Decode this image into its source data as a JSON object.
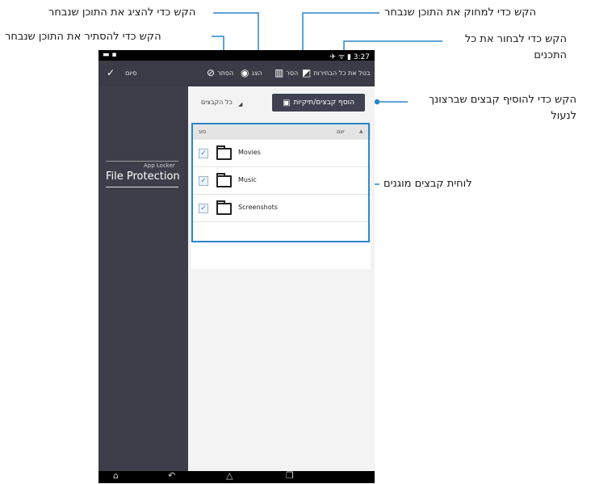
{
  "callouts": {
    "show": "הקש כדי להציג את התוכן שנבחר",
    "hide": "הקש כדי להסתיר את התוכן שנבחר",
    "delete": "הקש כדי למחוק את התוכן שנבחר",
    "select_all": "הקש כדי לבחור את כל התכנים",
    "add_files": "הקש כדי להוסיף קבצים שברצונך לנעול",
    "protected_list": "לוחית קבצים מוגנים"
  },
  "status_bar": {
    "time": "3:27",
    "left_icons": "▬ ▪",
    "right_icons": "✈ ᯤ ▮"
  },
  "action_bar": {
    "done_label": "סיום",
    "hide_label": "הסתר",
    "show_label": "הצג",
    "delete_label": "הסר",
    "deselect_all_label": "בטל את כל הבחירות"
  },
  "sidebar": {
    "subtitle": "App Locker",
    "title": "File Protection"
  },
  "main": {
    "filter_label": "כל הקבצים",
    "add_button_label": "הוסף קבצים/תיקיות",
    "columns": {
      "name": "שם",
      "type": "סוג"
    },
    "rows": [
      {
        "name": "Movies",
        "checked": true
      },
      {
        "name": "Music",
        "checked": true
      },
      {
        "name": "Screenshots",
        "checked": true
      }
    ]
  },
  "colors": {
    "accent": "#2b86c7",
    "action_bar": "#3a3b46",
    "sidebar": "#3d3e4a"
  },
  "icons": [
    "done-check-icon",
    "hide-eye-slash-icon",
    "show-eye-icon",
    "delete-trash-icon",
    "deselect-all-icon",
    "add-folder-icon",
    "folder-icon",
    "checkbox-icon",
    "back-icon",
    "home-icon",
    "recent-apps-icon"
  ]
}
